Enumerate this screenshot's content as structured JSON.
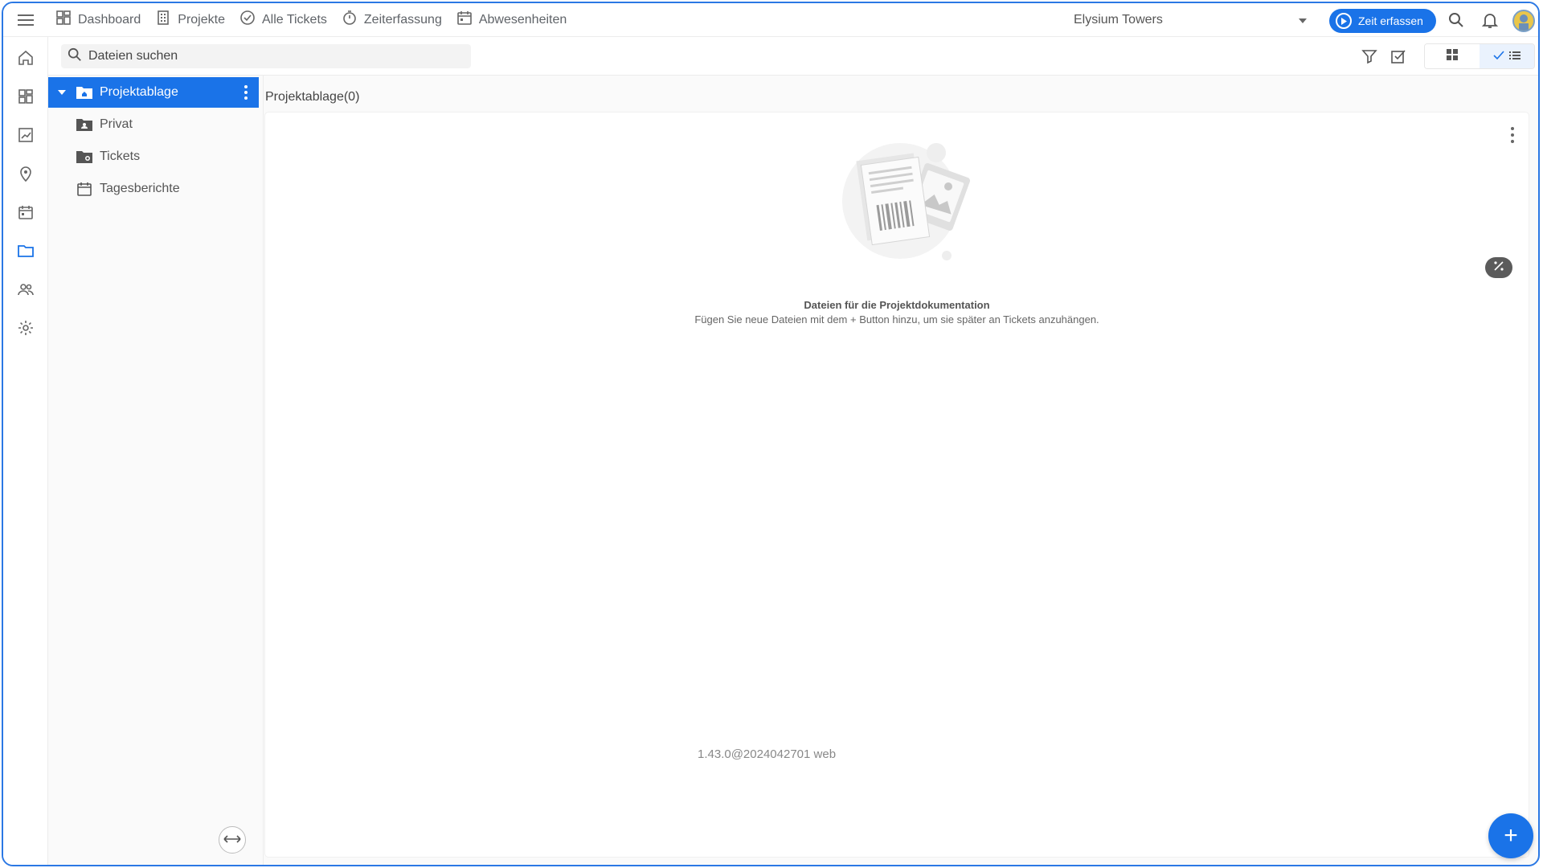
{
  "nav": {
    "items": [
      {
        "label": "Dashboard",
        "icon": "dashboard-icon"
      },
      {
        "label": "Projekte",
        "icon": "building-icon"
      },
      {
        "label": "Alle Tickets",
        "icon": "check-circle-icon"
      },
      {
        "label": "Zeiterfassung",
        "icon": "stopwatch-icon"
      },
      {
        "label": "Abwesenheiten",
        "icon": "calendar-icon"
      }
    ],
    "project": "Elysium Towers",
    "time_button": "Zeit erfassen"
  },
  "toolbar": {
    "search_placeholder": "Dateien suchen"
  },
  "tree": {
    "items": [
      {
        "label": "Projektablage",
        "icon": "folder-home-icon",
        "selected": true
      },
      {
        "label": "Privat",
        "icon": "folder-account-icon",
        "selected": false
      },
      {
        "label": "Tickets",
        "icon": "folder-ticket-icon",
        "selected": false
      },
      {
        "label": "Tagesberichte",
        "icon": "calendar-icon",
        "selected": false
      }
    ]
  },
  "main": {
    "breadcrumb": "Projektablage(0)",
    "empty_title": "Dateien für die Projektdokumentation",
    "empty_subtitle": "Fügen Sie neue Dateien mit dem + Button hinzu, um sie später an Tickets anzuhängen.",
    "version": "1.43.0@2024042701 web",
    "fab_label": "+"
  },
  "colors": {
    "accent": "#1a73e8",
    "frame": "#2b78e4"
  }
}
